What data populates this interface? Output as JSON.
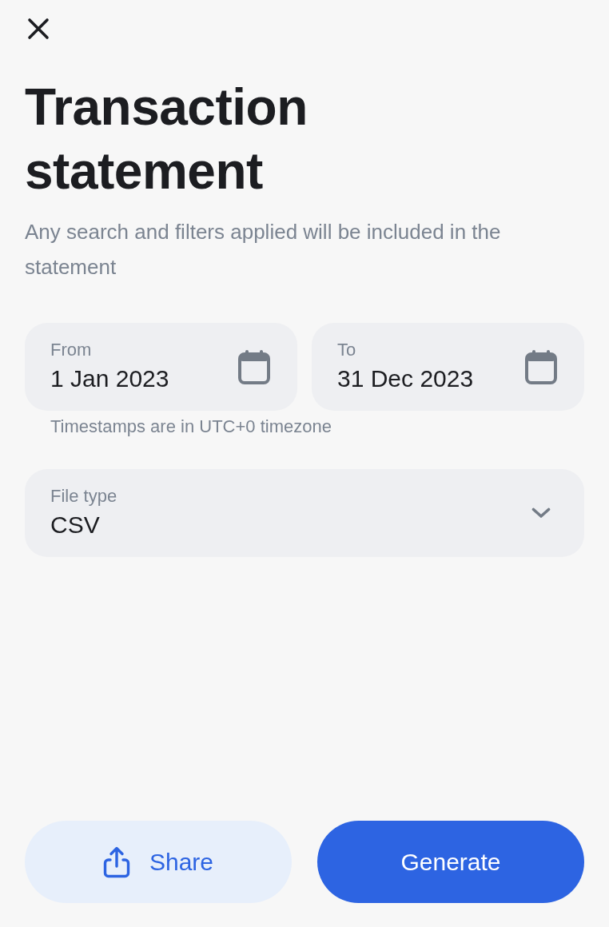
{
  "title": "Transaction statement",
  "subtitle": "Any search and filters applied will be included in the statement",
  "date_fields": [
    {
      "label": "From",
      "value": "1 Jan 2023"
    },
    {
      "label": "To",
      "value": "31 Dec 2023"
    }
  ],
  "date_hint": "Timestamps are in UTC+0 timezone",
  "file_type": {
    "label": "File type",
    "value": "CSV"
  },
  "buttons": [
    {
      "kind": "secondary",
      "label": "Share"
    },
    {
      "kind": "primary",
      "label": "Generate"
    }
  ]
}
